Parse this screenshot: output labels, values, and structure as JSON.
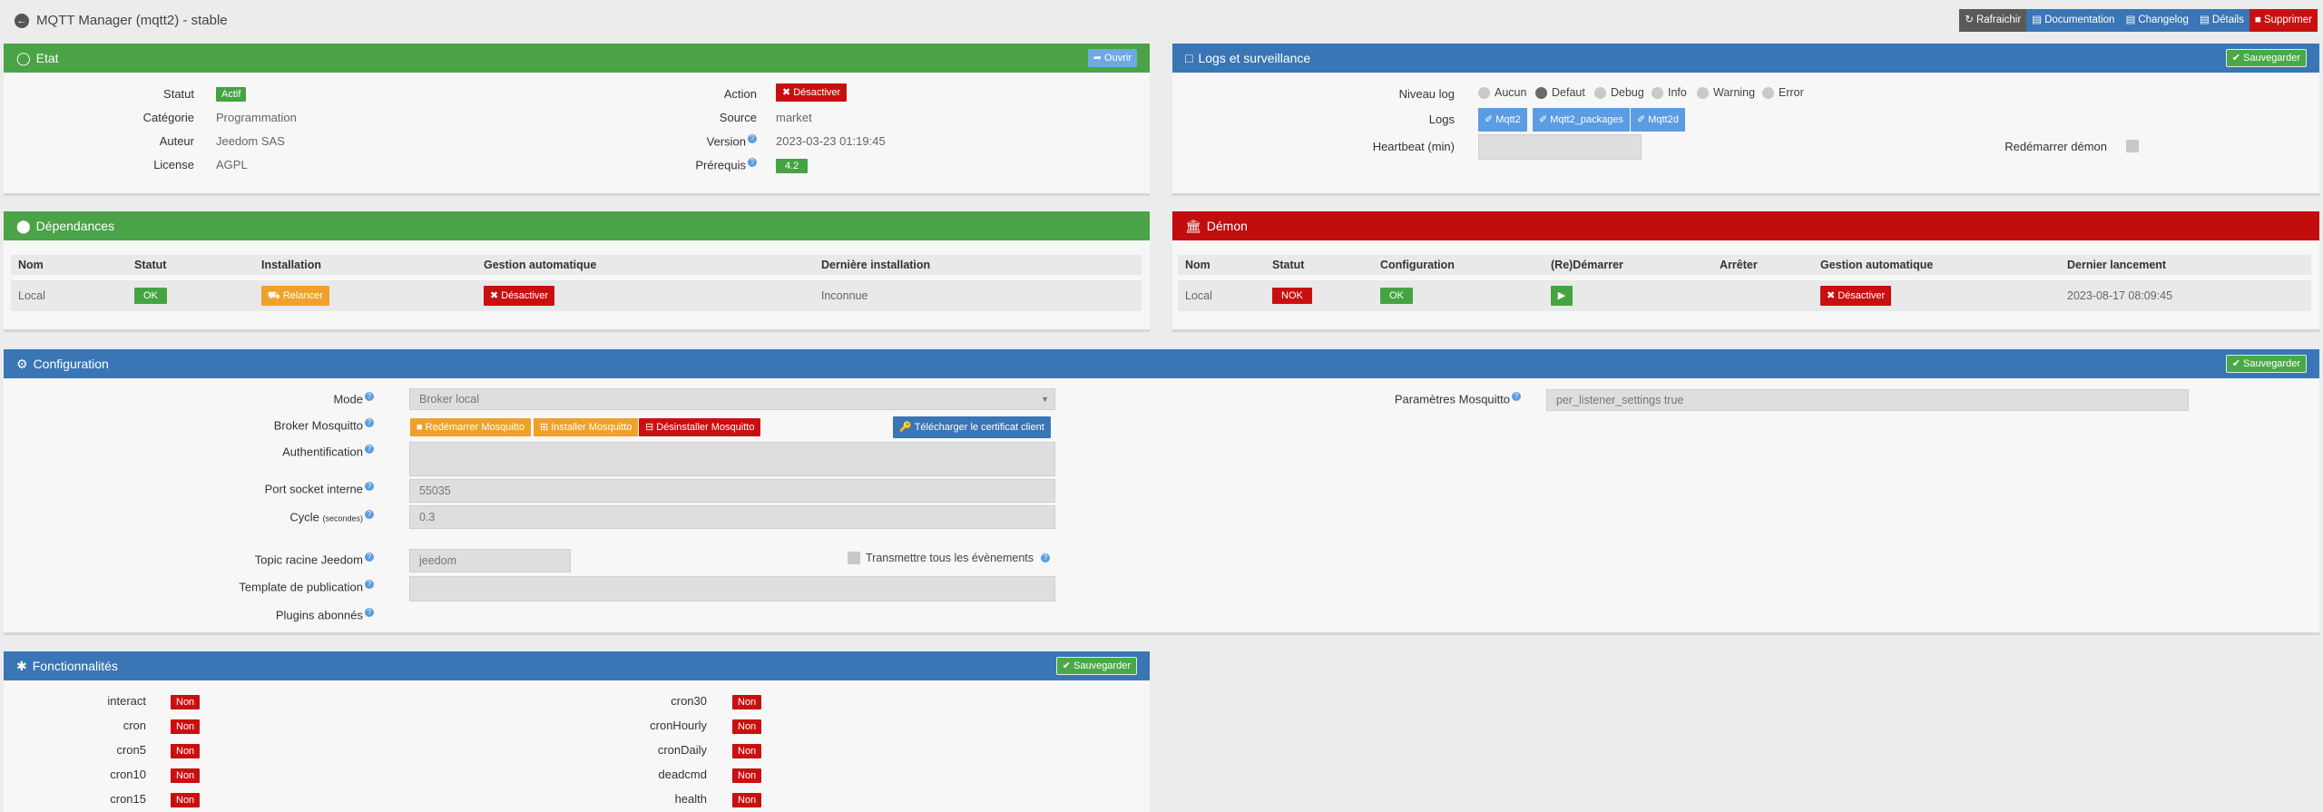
{
  "page": {
    "title": "MQTT Manager (mqtt2) - stable"
  },
  "topbar": {
    "refresh": "Rafraichir",
    "documentation": "Documentation",
    "changelog": "Changelog",
    "details": "Détails",
    "delete": "Supprimer"
  },
  "etat": {
    "title": "Etat",
    "open_btn": "Ouvrir",
    "rows": [
      {
        "label": "Statut",
        "value": "Actif"
      },
      {
        "label": "Catégorie",
        "value": "Programmation"
      },
      {
        "label": "Auteur",
        "value": "Jeedom SAS"
      },
      {
        "label": "License",
        "value": "AGPL"
      }
    ],
    "right": [
      {
        "label": "Action",
        "value": "Désactiver"
      },
      {
        "label": "Source",
        "value": "market"
      },
      {
        "label": "Version",
        "value": "2023-03-23 01:19:45"
      },
      {
        "label": "Prérequis",
        "value": "4.2"
      }
    ]
  },
  "logs": {
    "title": "Logs et surveillance",
    "save": "Sauvegarder",
    "level_label": "Niveau log",
    "levels": [
      "Aucun",
      "Defaut",
      "Debug",
      "Info",
      "Warning",
      "Error"
    ],
    "selected_level": "Defaut",
    "logs_label": "Logs",
    "log_buttons": [
      "Mqtt2",
      "Mqtt2_packages",
      "Mqtt2d"
    ],
    "heartbeat_label": "Heartbeat (min)",
    "restart_label": "Redémarrer démon"
  },
  "deps": {
    "title": "Dépendances",
    "headers": [
      "Nom",
      "Statut",
      "Installation",
      "Gestion automatique",
      "Dernière installation"
    ],
    "row": {
      "name": "Local",
      "status": "OK",
      "install": "Relancer",
      "auto": "Désactiver",
      "last": "Inconnue"
    }
  },
  "demon": {
    "title": "Démon",
    "headers": [
      "Nom",
      "Statut",
      "Configuration",
      "(Re)Démarrer",
      "Arrêter",
      "Gestion automatique",
      "Dernier lancement"
    ],
    "row": {
      "name": "Local",
      "status": "NOK",
      "config": "OK",
      "auto": "Désactiver",
      "last": "2023-08-17 08:09:45"
    }
  },
  "config": {
    "title": "Configuration",
    "save": "Sauvegarder",
    "mode_label": "Mode",
    "mode_value": "Broker local",
    "broker_label": "Broker Mosquitto",
    "broker_buttons": [
      "Redémarrer Mosquitto",
      "Installer Mosquitto",
      "Désinstaller Mosquitto"
    ],
    "cert_btn": "Télécharger le certificat client",
    "auth_label": "Authentification",
    "port_label": "Port socket interne",
    "port_value": "55035",
    "cycle_label": "Cycle",
    "cycle_unit": "(secondes)",
    "cycle_value": "0.3",
    "topic_label": "Topic racine Jeedom",
    "topic_value": "jeedom",
    "transmit_label": "Transmettre tous les évènements",
    "template_label": "Template de publication",
    "plugins_label": "Plugins abonnés",
    "mosq_params_label": "Paramètres Mosquitto",
    "mosq_params_value": "per_listener_settings true"
  },
  "fonct": {
    "title": "Fonctionnalités",
    "save": "Sauvegarder",
    "left": [
      {
        "name": "interact",
        "value": "Non"
      },
      {
        "name": "cron",
        "value": "Non"
      },
      {
        "name": "cron5",
        "value": "Non"
      },
      {
        "name": "cron10",
        "value": "Non"
      },
      {
        "name": "cron15",
        "value": "Non"
      }
    ],
    "right": [
      {
        "name": "cron30",
        "value": "Non"
      },
      {
        "name": "cronHourly",
        "value": "Non"
      },
      {
        "name": "cronDaily",
        "value": "Non"
      },
      {
        "name": "deadcmd",
        "value": "Non"
      },
      {
        "name": "health",
        "value": "Non"
      }
    ]
  }
}
